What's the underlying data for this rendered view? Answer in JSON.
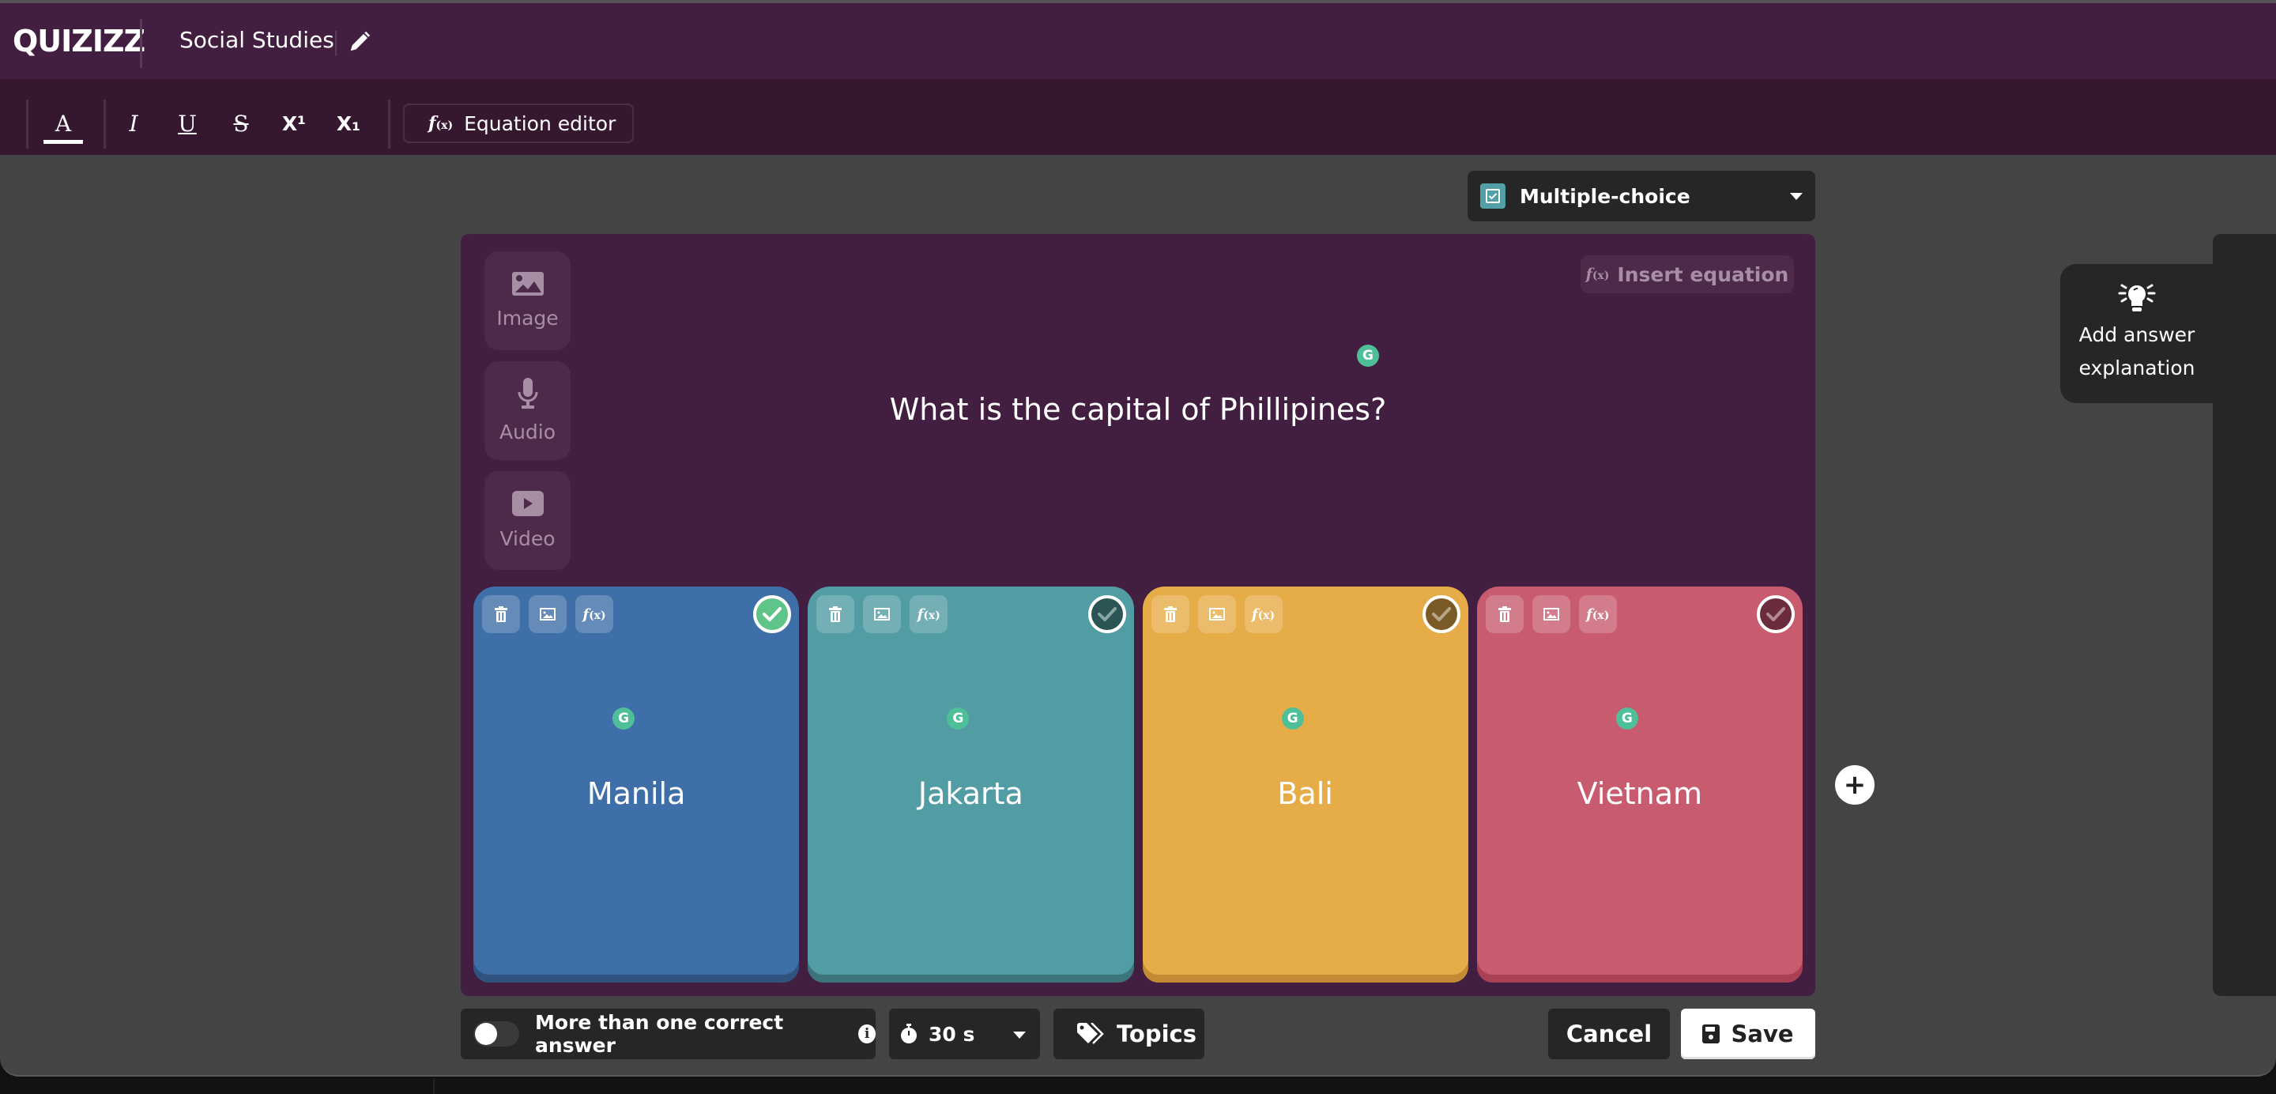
{
  "app": {
    "logo": "QUIZIZZ",
    "quiz_title": "Social Studies"
  },
  "toolbar": {
    "text_color_label": "A",
    "italic_label": "I",
    "underline_label": "U",
    "strike_label": "S",
    "superscript_label": "X¹",
    "subscript_label": "X₁",
    "equation_editor_label": "Equation editor"
  },
  "question_type": {
    "selected": "Multiple-choice",
    "icon": "checkbox-icon",
    "accent": "#52a0a7"
  },
  "media": [
    {
      "label": "Image",
      "icon": "image-icon"
    },
    {
      "label": "Audio",
      "icon": "microphone-icon"
    },
    {
      "label": "Video",
      "icon": "video-icon"
    }
  ],
  "editor": {
    "insert_equation_label": "Insert equation",
    "question_text": "What is the capital of Phillipines?",
    "grammarly_glyph": "G"
  },
  "answers": [
    {
      "text": "Manila",
      "color": "#3f6fa8",
      "shadow": "#2f527e",
      "correct": true,
      "check_bg": "#5ec48a",
      "check_mark": "#ffffff"
    },
    {
      "text": "Jakarta",
      "color": "#529ca4",
      "shadow": "#3d737a",
      "correct": false,
      "check_bg": "#2b5455",
      "check_mark": "#8aa3a3"
    },
    {
      "text": "Bali",
      "color": "#e5ac47",
      "shadow": "#c28a33",
      "correct": false,
      "check_bg": "#7a5a26",
      "check_mark": "#b7a68a"
    },
    {
      "text": "Vietnam",
      "color": "#c85c6e",
      "shadow": "#a94053",
      "correct": false,
      "check_bg": "#6b2d3d",
      "check_mark": "#b18a93"
    }
  ],
  "add_answer_label": "+",
  "explanation": {
    "line1": "Add answer",
    "line2": "explanation"
  },
  "footer": {
    "multi_correct_label": "More than one correct answer",
    "multi_correct_enabled": false,
    "info_glyph": "i",
    "timer_value": "30 s",
    "topics_label": "Topics",
    "cancel_label": "Cancel",
    "save_label": "Save"
  }
}
